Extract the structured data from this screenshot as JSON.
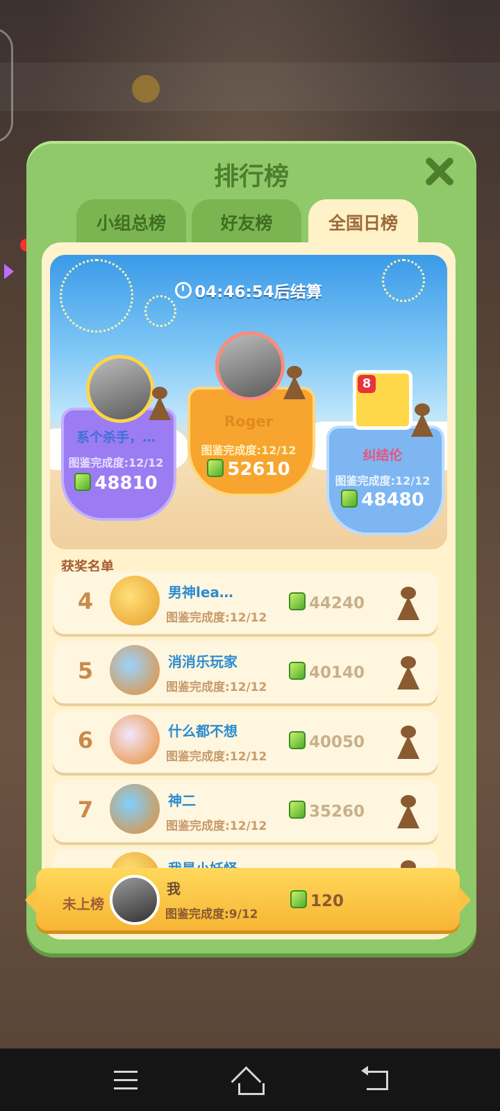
{
  "panel": {
    "title": "排行榜",
    "tabs": [
      {
        "label": "小组总榜",
        "active": false
      },
      {
        "label": "好友榜",
        "active": false
      },
      {
        "label": "全国日榜",
        "active": true
      }
    ]
  },
  "timer": "04:46:54后结算",
  "podium": [
    {
      "position": 1,
      "name": "Roger",
      "progress": "图鉴完成度:12/12",
      "score": "52610",
      "color": "#f7a52e"
    },
    {
      "position": 2,
      "name": "系个杀手，…",
      "progress": "图鉴完成度:12/12",
      "score": "48810",
      "color": "#9c7cf2"
    },
    {
      "position": 3,
      "name": "纠结伦",
      "progress": "图鉴完成度:12/12",
      "score": "48480",
      "color": "#7eb6f2"
    }
  ],
  "award_title": "获奖名单",
  "rows": [
    {
      "rank": "4",
      "name": "男神lea…",
      "progress": "图鉴完成度:12/12",
      "score": "44240"
    },
    {
      "rank": "5",
      "name": "消消乐玩家",
      "progress": "图鉴完成度:12/12",
      "score": "40140"
    },
    {
      "rank": "6",
      "name": "什么都不想",
      "progress": "图鉴完成度:12/12",
      "score": "40050"
    },
    {
      "rank": "7",
      "name": "神二",
      "progress": "图鉴完成度:12/12",
      "score": "35260"
    },
    {
      "rank": "",
      "name": "我是小妖怪…",
      "progress": "",
      "score": ""
    }
  ],
  "my_rank": {
    "status": "未上榜",
    "name": "我",
    "progress": "图鉴完成度:9/12",
    "score": "120"
  },
  "badge_number": "8"
}
